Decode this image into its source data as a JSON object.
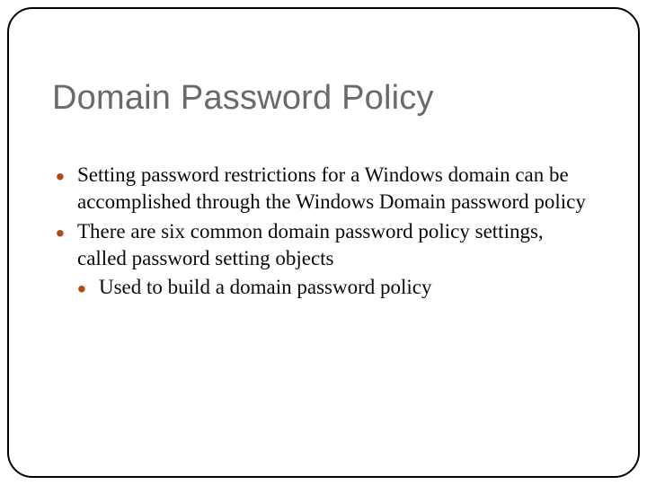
{
  "slide": {
    "title": "Domain Password Policy",
    "bullets": [
      {
        "text": "Setting password restrictions for a Windows domain can be accomplished through the Windows Domain password policy"
      },
      {
        "text": "There are six common domain password policy settings, called password setting objects",
        "sub": [
          {
            "text": "Used to build a domain password policy"
          }
        ]
      }
    ]
  },
  "colors": {
    "title": "#6a6a6a",
    "bullet_marker": "#b24a17",
    "text": "#0a0a0a",
    "frame": "#000000"
  }
}
